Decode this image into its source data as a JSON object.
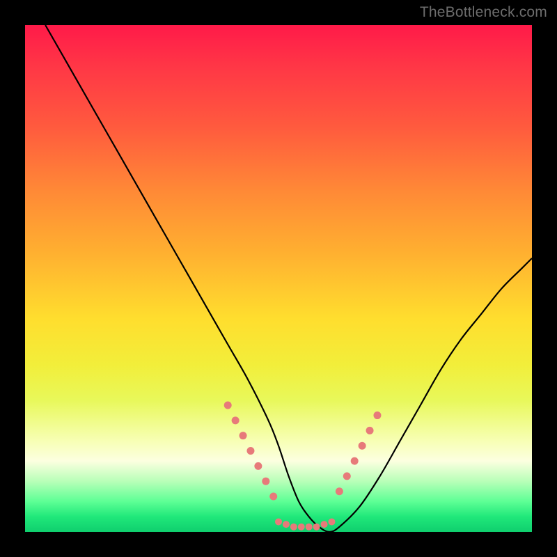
{
  "watermark": "TheBottleneck.com",
  "chart_data": {
    "type": "line",
    "title": "",
    "xlabel": "",
    "ylabel": "",
    "xlim": [
      0,
      100
    ],
    "ylim": [
      0,
      100
    ],
    "grid": false,
    "series": [
      {
        "name": "curve",
        "x": [
          4,
          8,
          12,
          16,
          20,
          24,
          28,
          32,
          36,
          40,
          44,
          48,
          50,
          52,
          54,
          56,
          58,
          60,
          62,
          66,
          70,
          74,
          78,
          82,
          86,
          90,
          94,
          98,
          100
        ],
        "values": [
          100,
          93,
          86,
          79,
          72,
          65,
          58,
          51,
          44,
          37,
          30,
          22,
          17,
          11,
          6,
          3,
          1,
          0,
          1,
          5,
          11,
          18,
          25,
          32,
          38,
          43,
          48,
          52,
          54
        ]
      }
    ],
    "markers": {
      "comment": "salmon dotted segments near the valley",
      "color": "#e77a7a",
      "left_segment": {
        "x": [
          40,
          41.5,
          43,
          44.5,
          46,
          47.5,
          49
        ],
        "y": [
          25,
          22,
          19,
          16,
          13,
          10,
          7
        ]
      },
      "right_segment": {
        "x": [
          62,
          63.5,
          65,
          66.5,
          68,
          69.5
        ],
        "y": [
          8,
          11,
          14,
          17,
          20,
          23
        ]
      },
      "bottom_row": {
        "x": [
          50,
          51.5,
          53,
          54.5,
          56,
          57.5,
          59,
          60.5
        ],
        "y": [
          2,
          1.5,
          1,
          1,
          1,
          1,
          1.5,
          2
        ]
      }
    }
  }
}
